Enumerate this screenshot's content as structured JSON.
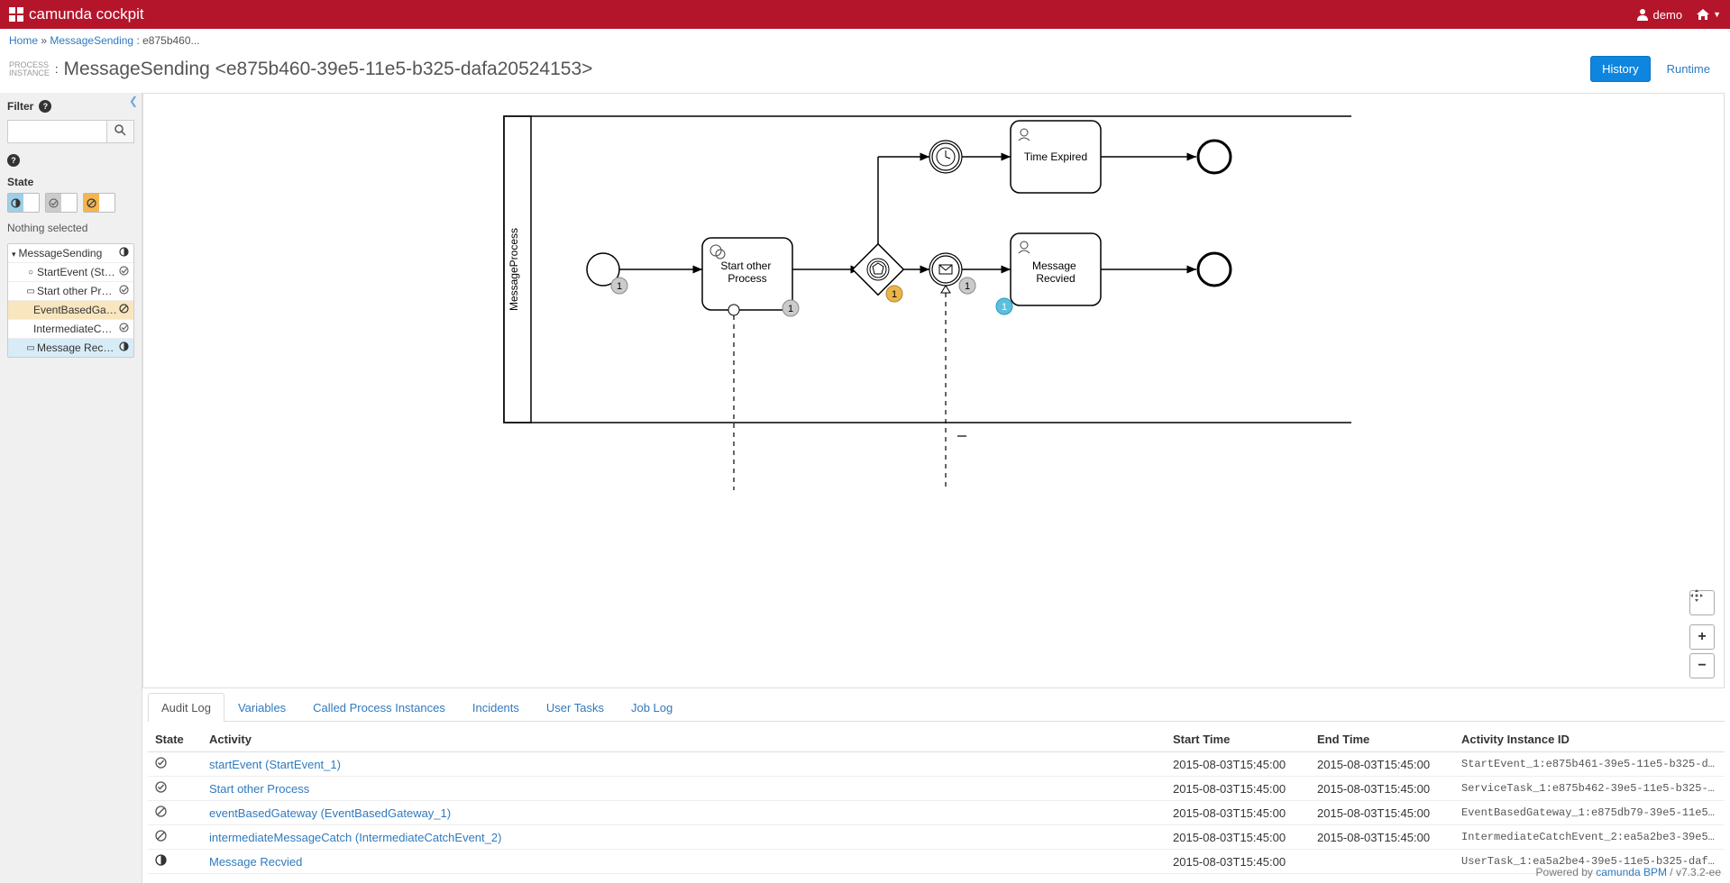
{
  "header": {
    "app_name": "camunda cockpit",
    "user": "demo"
  },
  "breadcrumb": {
    "home": "Home",
    "process": "MessageSending",
    "instance_short": "e875b460..."
  },
  "title": {
    "tag1": "PROCESS",
    "tag2": "INSTANCE",
    "main": "MessageSending <e875b460-39e5-11e5-b325-dafa20524153>",
    "history_btn": "History",
    "runtime_btn": "Runtime"
  },
  "sidebar": {
    "filter_label": "Filter",
    "search_placeholder": "",
    "state_label": "State",
    "nothing_selected": "Nothing selected",
    "tree": {
      "root": "MessageSending",
      "items": [
        {
          "label": "StartEvent (StartE...",
          "end": "completed"
        },
        {
          "label": "Start other Process",
          "end": "completed"
        },
        {
          "label": "EventBasedGate...",
          "end": "canceled"
        },
        {
          "label": "IntermediateCatc...",
          "end": "completed"
        },
        {
          "label": "Message Recvied",
          "end": "running"
        }
      ]
    }
  },
  "diagram": {
    "pool_label": "MessageProcess",
    "task_start_other": "Start other Process",
    "task_time_expired": "Time Expired",
    "task_message_recvied": "Message Recvied",
    "badge_start": "1",
    "badge_task1": "1",
    "badge_gateway": "1",
    "badge_msg": "1",
    "badge_msg_blue": "1"
  },
  "tabs": {
    "items": [
      "Audit Log",
      "Variables",
      "Called Process Instances",
      "Incidents",
      "User Tasks",
      "Job Log"
    ]
  },
  "table": {
    "headers": {
      "state": "State",
      "activity": "Activity",
      "start": "Start Time",
      "end": "End Time",
      "id": "Activity Instance ID"
    },
    "rows": [
      {
        "state": "completed",
        "activity": "startEvent (StartEvent_1)",
        "start": "2015-08-03T15:45:00",
        "end": "2015-08-03T15:45:00",
        "id": "StartEvent_1:e875b461-39e5-11e5-b325-dafa..."
      },
      {
        "state": "completed",
        "activity": "Start other Process",
        "start": "2015-08-03T15:45:00",
        "end": "2015-08-03T15:45:00",
        "id": "ServiceTask_1:e875b462-39e5-11e5-b325-daf..."
      },
      {
        "state": "canceled",
        "activity": "eventBasedGateway (EventBasedGateway_1)",
        "start": "2015-08-03T15:45:00",
        "end": "2015-08-03T15:45:00",
        "id": "EventBasedGateway_1:e875db79-39e5-11e5-b3..."
      },
      {
        "state": "canceled",
        "activity": "intermediateMessageCatch (IntermediateCatchEvent_2)",
        "start": "2015-08-03T15:45:00",
        "end": "2015-08-03T15:45:00",
        "id": "IntermediateCatchEvent_2:ea5a2be3-39e5-11..."
      },
      {
        "state": "running",
        "activity": "Message Recvied",
        "start": "2015-08-03T15:45:00",
        "end": "",
        "id": "UserTask_1:ea5a2be4-39e5-11e5-b325-dafa20..."
      }
    ]
  },
  "footer": {
    "powered": "Powered by ",
    "link": "camunda BPM",
    "version": " / v7.3.2-ee"
  }
}
